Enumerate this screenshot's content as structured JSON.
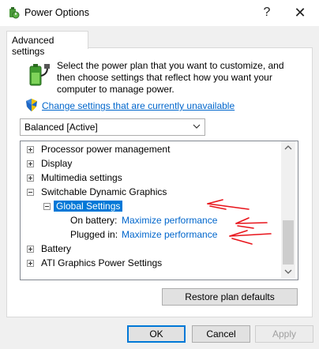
{
  "window": {
    "title": "Power Options",
    "help_glyph": "?",
    "close_glyph": "✕"
  },
  "tab": {
    "label": "Advanced settings"
  },
  "description": "Select the power plan that you want to customize, and then choose settings that reflect how you want your computer to manage power.",
  "change_link": "Change settings that are currently unavailable",
  "plan": {
    "selected": "Balanced [Active]"
  },
  "tree": {
    "processor": "Processor power management",
    "display": "Display",
    "multimedia": "Multimedia settings",
    "switchable": "Switchable Dynamic Graphics",
    "global_settings": "Global Settings",
    "on_battery_label": "On battery:",
    "on_battery_value": "Maximize performance",
    "plugged_in_label": "Plugged in:",
    "plugged_in_value": "Maximize performance",
    "battery": "Battery",
    "ati": "ATI Graphics Power Settings"
  },
  "buttons": {
    "restore": "Restore plan defaults",
    "ok": "OK",
    "cancel": "Cancel",
    "apply": "Apply"
  },
  "icons": {
    "app": "power-options-icon",
    "battery": "battery-plug-icon",
    "shield": "uac-shield-icon",
    "chevron": "chevron-down-icon"
  },
  "colors": {
    "accent": "#0078d7",
    "link": "#0066cc",
    "annotation": "#e8141b"
  }
}
